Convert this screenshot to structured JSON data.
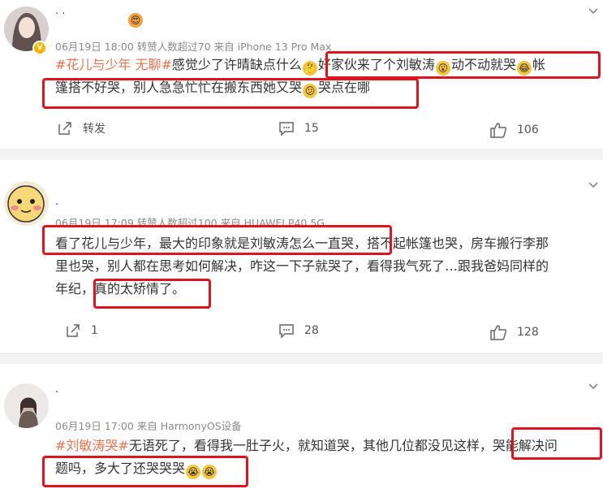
{
  "posts": [
    {
      "meta": "06月19日 18:00 转赞人数超过70  来自 iPhone 13 Pro Max",
      "line1_tag": "#花儿与少年 无聊#",
      "line1_a": "感觉少了许晴缺点什么",
      "line1_b": "好家伙来了个刘敏涛",
      "line1_c": "动不动就哭",
      "line1_d": "帐",
      "line2_a": "篷搭不好哭，别人急急忙忙在搬东西她又哭",
      "line2_b": "哭点在哪",
      "share": "转发",
      "comments": "15",
      "likes": "106"
    },
    {
      "meta": "06月19日 17:09 转赞人数超过100  来自 HUAWEI P40 5G",
      "line1": "看了花儿与少年，最大的印象就是刘敏涛怎么一直哭，搭不起帐篷也哭，房车搬行李那",
      "line2": "里也哭，别人都在思考如何解决，咋这一下子就哭了，看得我气死了…跟我爸妈同样的",
      "line3": "年纪，真的太矫情了。",
      "share": "1",
      "comments": "28",
      "likes": "128"
    },
    {
      "meta": "06月19日 17:00  来自 HarmonyOS设备",
      "line1_tag": "#刘敏涛哭#",
      "line1": "无语死了，看得我一肚子火，就知道哭，其他几位都没见这样，哭能解决问",
      "line2": "题吗，多大了还哭哭哭"
    }
  ],
  "icons": {
    "emoji_color": "#f5c542",
    "accent": "#eb7350",
    "highlight": "#e0141e"
  }
}
